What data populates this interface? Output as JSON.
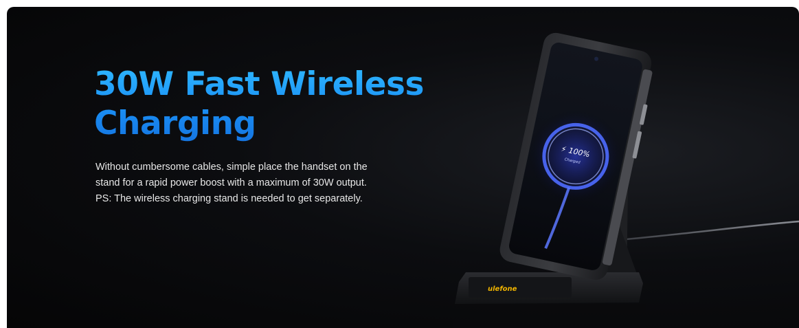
{
  "hero": {
    "title_line1": "30W Fast Wireless",
    "title_line2": "Charging",
    "description_lines": [
      "Without cumbersome cables, simple place the handset on the",
      "stand for a rapid power boost with a maximum of 30W output.",
      "PS: The wireless charging stand is needed to get separately."
    ]
  },
  "product": {
    "screen_percent": "⚡ 100%",
    "screen_status": "Charged",
    "brand": "ulefone"
  },
  "colors": {
    "headline_blue": "#1a8ff5",
    "banner_background": "#0a0b0d",
    "brand_yellow": "#f0b400",
    "charge_ring": "#4e6bff"
  }
}
